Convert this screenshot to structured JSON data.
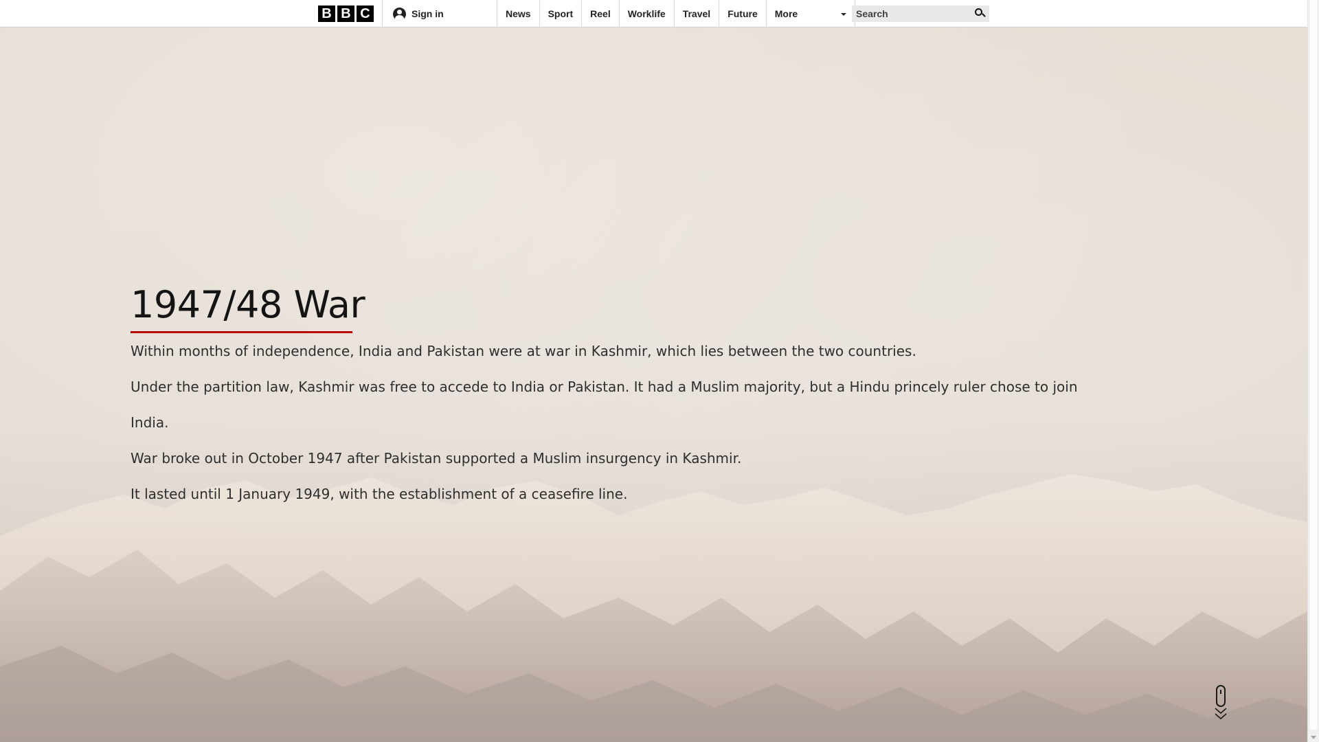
{
  "brand": {
    "letters": [
      "B",
      "B",
      "C"
    ]
  },
  "account": {
    "sign_in_label": "Sign in"
  },
  "nav": {
    "items": [
      "News",
      "Sport",
      "Reel",
      "Worklife",
      "Travel",
      "Future"
    ],
    "more_label": "More"
  },
  "search": {
    "placeholder": "Search"
  },
  "article": {
    "title": "1947/48 War",
    "paragraphs": [
      "Within months of independence, India and Pakistan were at war in Kashmir, which lies between the two countries.",
      "Under the partition law, Kashmir was free to accede to India or Pakistan. It had a Muslim majority, but a Hindu princely ruler chose to join India.",
      "War broke out in October 1947 after Pakistan supported a Muslim insurgency in Kashmir.",
      "It lasted until 1 January 1949, with the establishment of a ceasefire line."
    ]
  },
  "colors": {
    "accent_underline": "#b80000",
    "nav_background": "#ffffff",
    "text": "#141414"
  },
  "icons": {
    "account": "user-avatar-icon",
    "search": "magnifier-icon",
    "more": "caret-down-icon",
    "scroll": "mouse-scroll-icon"
  }
}
